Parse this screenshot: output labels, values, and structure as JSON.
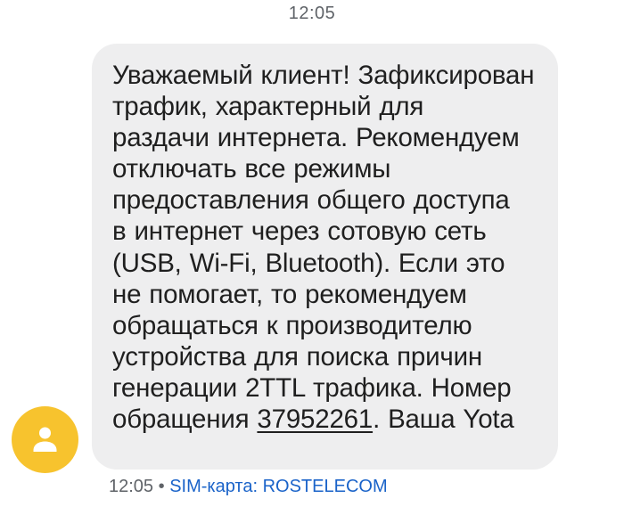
{
  "header": {
    "time": "12:05"
  },
  "message": {
    "lines": [
      "Уважаемый клиент! Зафиксирован",
      "трафик, характерный для",
      "раздачи интернета. Рекомендуем",
      "отключать все режимы",
      "предоставления общего доступа",
      "в интернет через сотовую сеть",
      "(USB, Wi-Fi, Bluetooth). Если это",
      "не помогает, то рекомендуем",
      "обращаться к производителю",
      "устройства для поиска причин",
      "генерации 2TTL трафика. Номер"
    ],
    "last_line_prefix": "обращения",
    "ticket_number": "37952261",
    "last_line_suffix": ". Ваша Yota"
  },
  "meta": {
    "time": "12:05",
    "separator": "•",
    "sim_label": "SIM-карта: ROSTELECOM"
  },
  "avatar": {
    "icon": "person-icon",
    "color": "#f7c32e"
  }
}
